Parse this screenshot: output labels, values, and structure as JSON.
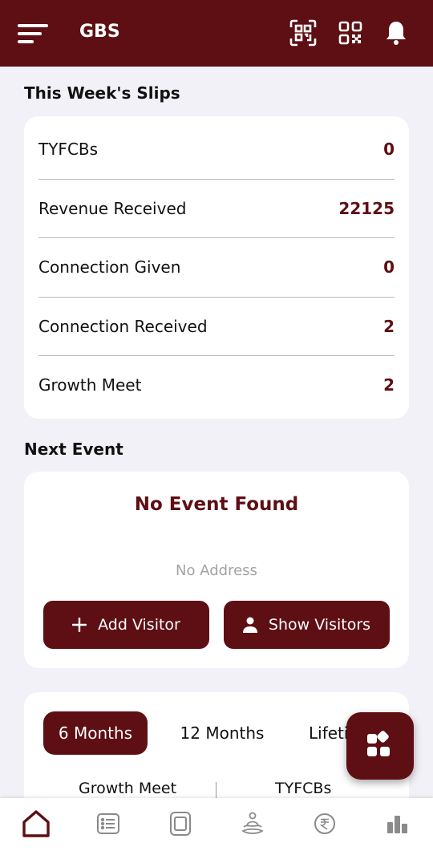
{
  "app": {
    "title": "GBS"
  },
  "slips": {
    "title": "This Week's Slips",
    "rows": [
      {
        "label": "TYFCBs",
        "value": "0"
      },
      {
        "label": "Revenue Received",
        "value": "22125"
      },
      {
        "label": "Connection Given",
        "value": "0"
      },
      {
        "label": "Connection Received",
        "value": "2"
      },
      {
        "label": "Growth Meet",
        "value": "2"
      }
    ]
  },
  "event": {
    "section_title": "Next Event",
    "title": "No Event Found",
    "address": "No Address",
    "add_visitor_label": "Add Visitor",
    "show_visitors_label": "Show Visitors"
  },
  "period_tabs": {
    "items": [
      {
        "label": "6 Months",
        "active": true
      },
      {
        "label": "12 Months",
        "active": false
      },
      {
        "label": "Lifetime",
        "active": false
      }
    ],
    "stats": [
      "Growth Meet",
      "TYFCBs"
    ]
  },
  "icons": {
    "menu": "menu-icon",
    "scan": "qr-scan-icon",
    "qr": "qr-code-icon",
    "notifications": "bell-icon",
    "fab": "apps-grid-icon",
    "nav": [
      "home-icon",
      "list-icon",
      "tablet-icon",
      "meditation-icon",
      "rupee-icon",
      "bar-chart-icon"
    ]
  },
  "colors": {
    "primary": "#5e0f14",
    "background": "#f2f1f7",
    "muted": "#a3a3a3"
  }
}
